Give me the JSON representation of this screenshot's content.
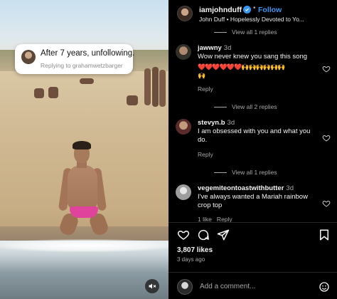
{
  "media": {
    "tooltip": {
      "title": "After 7 years, unfollowing.",
      "subtitle": "Replying to grahamwetzbarger"
    },
    "mute_icon": "speaker-muted-icon"
  },
  "header": {
    "username": "iamjohnduff",
    "separator": "•",
    "follow_label": "Follow",
    "subtitle": "John Duff • Hopelessly Devoted to Yo..."
  },
  "comments": [
    {
      "view_replies_above": "View all 1 replies",
      "username": "jawwny",
      "time": "3d",
      "text": "Wow never knew you sang this song",
      "emoji_line": "❤️❤️❤️❤️❤️❤️🙌🙌🙌🙌🙌🙌",
      "emoji_line2": "🙌",
      "reply_label": "Reply",
      "view_replies_below": "View all 2 replies"
    },
    {
      "username": "stevyn.b",
      "time": "3d",
      "text": "I am obsessed with you and what you do.",
      "reply_label": "Reply",
      "view_replies_below": "View all 1 replies"
    },
    {
      "username": "vegemiteontoastwithbutter",
      "time": "3d",
      "text": "I've always wanted a Mariah rainbow crop top",
      "meta": "1 like   Reply"
    }
  ],
  "actions": {
    "icons": [
      "heart-icon",
      "comment-icon",
      "share-icon",
      "save-icon"
    ]
  },
  "likes": "3,807 likes",
  "posted": "3 days ago",
  "composer": {
    "placeholder": "Add a comment..."
  }
}
